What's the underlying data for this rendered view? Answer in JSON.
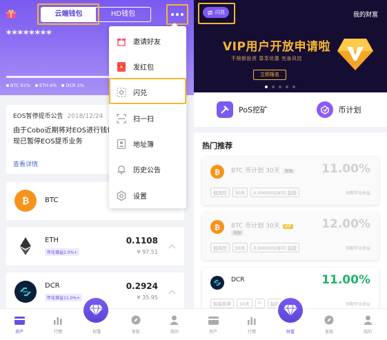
{
  "left": {
    "wallet_tabs": [
      "云端钱包",
      "HD钱包"
    ],
    "masked_balance": "********",
    "asset_legend": [
      "BTC 91%",
      "ETH 6%",
      "DCR 2%"
    ],
    "notice": {
      "title": "EOS暂停提币公告",
      "date": "2018/12/24",
      "body": "由于Cobo近期将对EOS进行钱包现已暂停EOS提币业务",
      "more": "查看详情"
    },
    "coins": [
      {
        "name": "BTC",
        "amount": "",
        "cny": "",
        "badge": ""
      },
      {
        "name": "ETH",
        "amount": "0.1108",
        "cny": "¥ 97.51",
        "badge": "年化增益2.0%+"
      },
      {
        "name": "DCR",
        "amount": "0.2924",
        "cny": "¥ 35.95",
        "badge": "年化增益11.0%+"
      }
    ],
    "menu": [
      "邀请好友",
      "发红包",
      "闪兑",
      "扫一扫",
      "地址簿",
      "历史公告",
      "设置"
    ],
    "nav": [
      "资产",
      "行情",
      "财富",
      "发现",
      "我的"
    ]
  },
  "right": {
    "flash_label": "闪兑",
    "title": "我的财富",
    "banner": {
      "title": "VIP用户开放申请啦",
      "subtitle": "不限额投资  尊享优惠  完善风控",
      "button": "立即报名"
    },
    "features": [
      "PoS挖矿",
      "币计划"
    ],
    "hot_title": "热门推荐",
    "products": [
      {
        "name": "BTC 币计划 30天",
        "badge": "限额",
        "rate": "11.00%",
        "tags": [
          "低风险",
          "30天",
          "0.0000002BTC 起投"
        ],
        "note": "预期年化收益"
      },
      {
        "name": "BTC 币计划 30天",
        "badge": "VIP",
        "badge2": "限额",
        "rate": "12.00%",
        "tags": [
          "低风险",
          "30天",
          "0.0000002BTC 起投"
        ],
        "note": "预期年化收益"
      },
      {
        "name": "DCR",
        "badge": "",
        "rate": "11.00%",
        "tags": [
          "智能投票",
          "30天",
          "0.",
          "起投"
        ],
        "note": "预期年化收益"
      }
    ],
    "nav": [
      "资产",
      "行情",
      "财富",
      "发现",
      "我的"
    ]
  },
  "colors": {
    "brand": "#6b4ce0",
    "highlight": "#f5b731",
    "green": "#1fb36b",
    "btc": "#f7931a"
  }
}
